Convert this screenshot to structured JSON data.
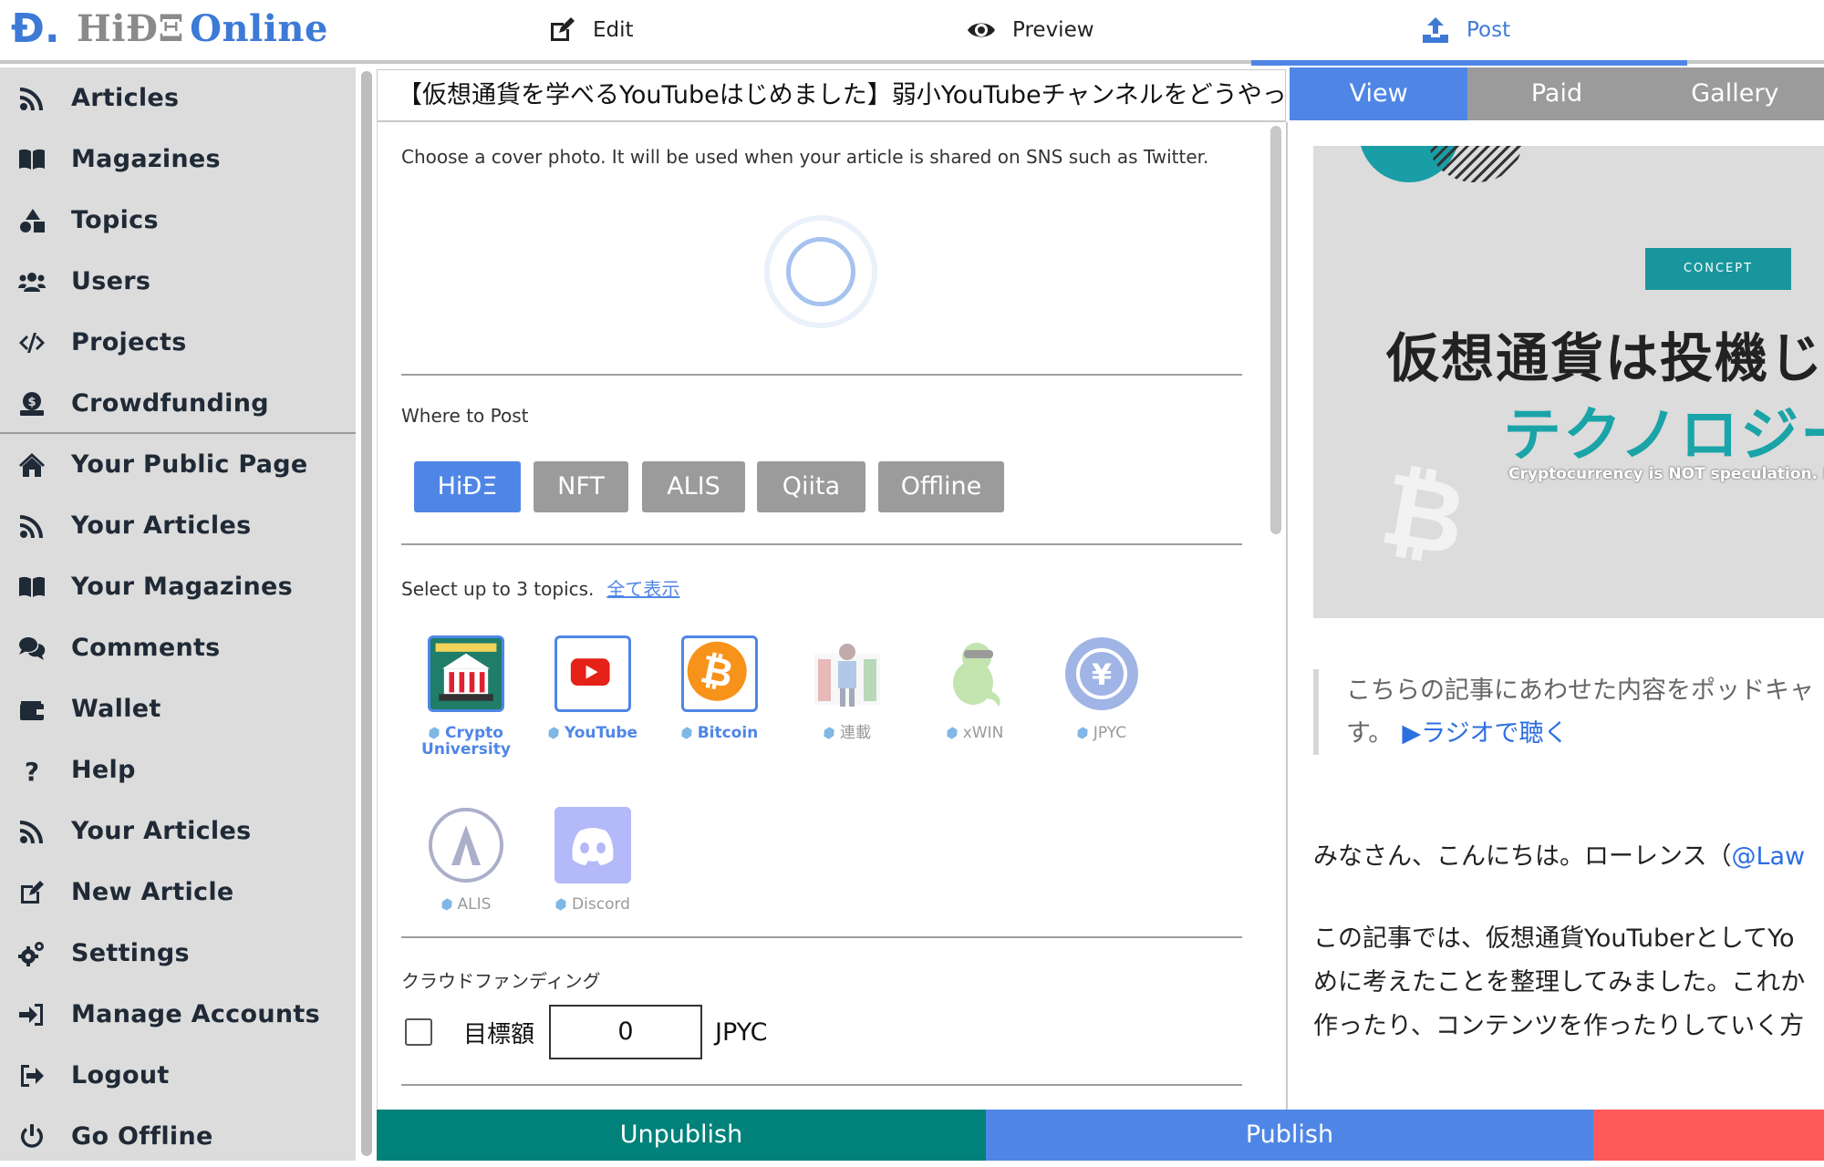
{
  "header": {
    "logo_mark": "Ð.",
    "logo_part1": "HiÐΞ",
    "logo_part2": "Online",
    "nav": {
      "edit": "Edit",
      "preview": "Preview",
      "post": "Post"
    }
  },
  "sidebar": {
    "items": [
      {
        "label": "Articles",
        "icon": "rss-icon"
      },
      {
        "label": "Magazines",
        "icon": "book-icon"
      },
      {
        "label": "Topics",
        "icon": "shapes-icon"
      },
      {
        "label": "Users",
        "icon": "users-icon"
      },
      {
        "label": "Projects",
        "icon": "code-icon"
      },
      {
        "label": "Crowdfunding",
        "icon": "money-icon"
      },
      {
        "label": "Your Public Page",
        "icon": "home-icon"
      },
      {
        "label": "Your Articles",
        "icon": "rss-icon"
      },
      {
        "label": "Your Magazines",
        "icon": "book-icon"
      },
      {
        "label": "Comments",
        "icon": "comments-icon"
      },
      {
        "label": "Wallet",
        "icon": "wallet-icon"
      },
      {
        "label": "Help",
        "icon": "question-icon"
      },
      {
        "label": "Your Articles",
        "icon": "rss-icon"
      },
      {
        "label": "New Article",
        "icon": "edit-icon"
      },
      {
        "label": "Settings",
        "icon": "gears-icon"
      },
      {
        "label": "Manage Accounts",
        "icon": "sign-in-icon"
      },
      {
        "label": "Logout",
        "icon": "sign-out-icon"
      },
      {
        "label": "Go Offline",
        "icon": "power-icon"
      }
    ]
  },
  "editor": {
    "title": "【仮想通貨を学べるYouTubeはじめました】弱小YouTubeチャンネルをどうやって",
    "cover_hint": "Choose a cover photo. It will be used when your article is shared on SNS such as Twitter.",
    "where_label": "Where to Post",
    "platforms": [
      "HiÐΞ",
      "NFT",
      "ALIS",
      "Qiita",
      "Offline"
    ],
    "topics_label": "Select up to 3 topics.",
    "show_all": "全て表示",
    "topics": [
      {
        "name1": "Crypto",
        "name2": "University",
        "selected": true
      },
      {
        "name1": "YouTube",
        "name2": "",
        "selected": true
      },
      {
        "name1": "Bitcoin",
        "name2": "",
        "selected": true
      },
      {
        "name1": "連載",
        "name2": "",
        "selected": false
      },
      {
        "name1": "xWIN",
        "name2": "",
        "selected": false
      },
      {
        "name1": "JPYC",
        "name2": "",
        "selected": false
      },
      {
        "name1": "ALIS",
        "name2": "",
        "selected": false
      },
      {
        "name1": "Discord",
        "name2": "",
        "selected": false
      }
    ],
    "crowdfunding_label": "クラウドファンディング",
    "goal_label": "目標額",
    "goal_value": "0",
    "goal_unit": "JPYC"
  },
  "bottom": {
    "unpublish": "Unpublish",
    "publish": "Publish"
  },
  "preview": {
    "tabs": [
      "View",
      "Paid",
      "Gallery"
    ],
    "cover": {
      "badge": "CONCEPT",
      "headline1": "仮想通貨は投機じ",
      "headline2": "テクノロジー",
      "subline": "Cryptocurrency is NOT speculation. It",
      "btc": "₿"
    },
    "quote_line1": "こちらの記事にあわせた内容をポッドキャ",
    "quote_line2": "す。",
    "quote_link": "▶ラジオで聴く",
    "para1": "みなさん、こんにちは。ローレンス（",
    "para1_link": "@Law",
    "para2_line1": "この記事では、仮想通貨YouTuberとしてYo",
    "para2_line2": "めに考えたことを整理してみました。これか",
    "para2_line3": "作ったり、コンテンツを作ったりしていく方"
  },
  "colors": {
    "accent": "#4f86e6",
    "teal": "#00827a",
    "red": "#ff5a5a",
    "sidebar_bg": "#dcdcdc"
  }
}
